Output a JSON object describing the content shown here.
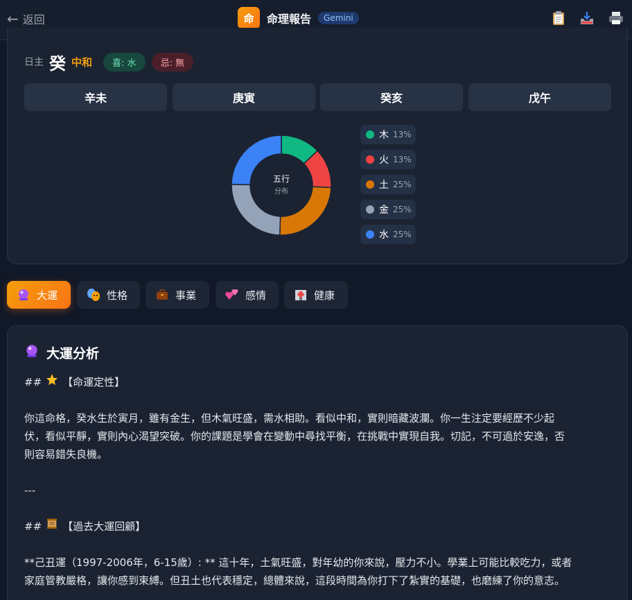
{
  "header": {
    "back_label": "返回",
    "logo_char": "命",
    "title": "命理報告",
    "model_badge": "Gemini"
  },
  "toolbar_icons": [
    "clipboard-icon",
    "inbox-tray-icon",
    "printer-icon"
  ],
  "summary": {
    "day_master_label": "日主",
    "day_master_char": "癸",
    "strength": "中和",
    "favorable": "喜: 水",
    "unfavorable": "忌: 無"
  },
  "pillars": [
    "辛未",
    "庚寅",
    "癸亥",
    "戊午"
  ],
  "chart_data": {
    "type": "pie",
    "center_title": "五行",
    "center_subtitle": "分布",
    "categories": [
      "木",
      "火",
      "土",
      "金",
      "水"
    ],
    "values": [
      13,
      13,
      25,
      25,
      25
    ],
    "percent_labels": [
      "13%",
      "13%",
      "25%",
      "25%",
      "25%"
    ],
    "colors": [
      "#10b981",
      "#ef4444",
      "#d97706",
      "#94a3b8",
      "#3b82f6"
    ],
    "legend_position": "right"
  },
  "tabs": [
    {
      "icon": "crystal-ball-icon",
      "label": "大運",
      "active": true
    },
    {
      "icon": "performing-arts-icon",
      "label": "性格",
      "active": false
    },
    {
      "icon": "briefcase-icon",
      "label": "事業",
      "active": false
    },
    {
      "icon": "two-hearts-icon",
      "label": "感情",
      "active": false
    },
    {
      "icon": "hospital-icon",
      "label": "健康",
      "active": false
    }
  ],
  "content": {
    "section_title": "大運分析",
    "heading1_prefix": "##",
    "heading1_text": "【命運定性】",
    "paragraph1_line1": "你這命格，癸水生於寅月，雖有金生，但木氣旺盛，需水相助。看似中和，實則暗藏波瀾。你一生注定要經歷不少起",
    "paragraph1_line2": "伏，看似平靜，實則內心渴望突破。你的課題是學會在變動中尋找平衡，在挑戰中實現自我。切記，不可過於安逸，否",
    "paragraph1_line3": "則容易錯失良機。",
    "divider": "---",
    "heading2_prefix": "##",
    "heading2_text": "【過去大運回顧】",
    "paragraph2_line1": "**己丑運（1997-2006年，6-15歲）: ** 這十年，土氣旺盛，對年幼的你來說，壓力不小。學業上可能比較吃力，或者",
    "paragraph2_line2": "家庭管教嚴格，讓你感到束縛。但丑土也代表穩定，總體來說，這段時間為你打下了紮實的基礎，也磨練了你的意志。"
  }
}
